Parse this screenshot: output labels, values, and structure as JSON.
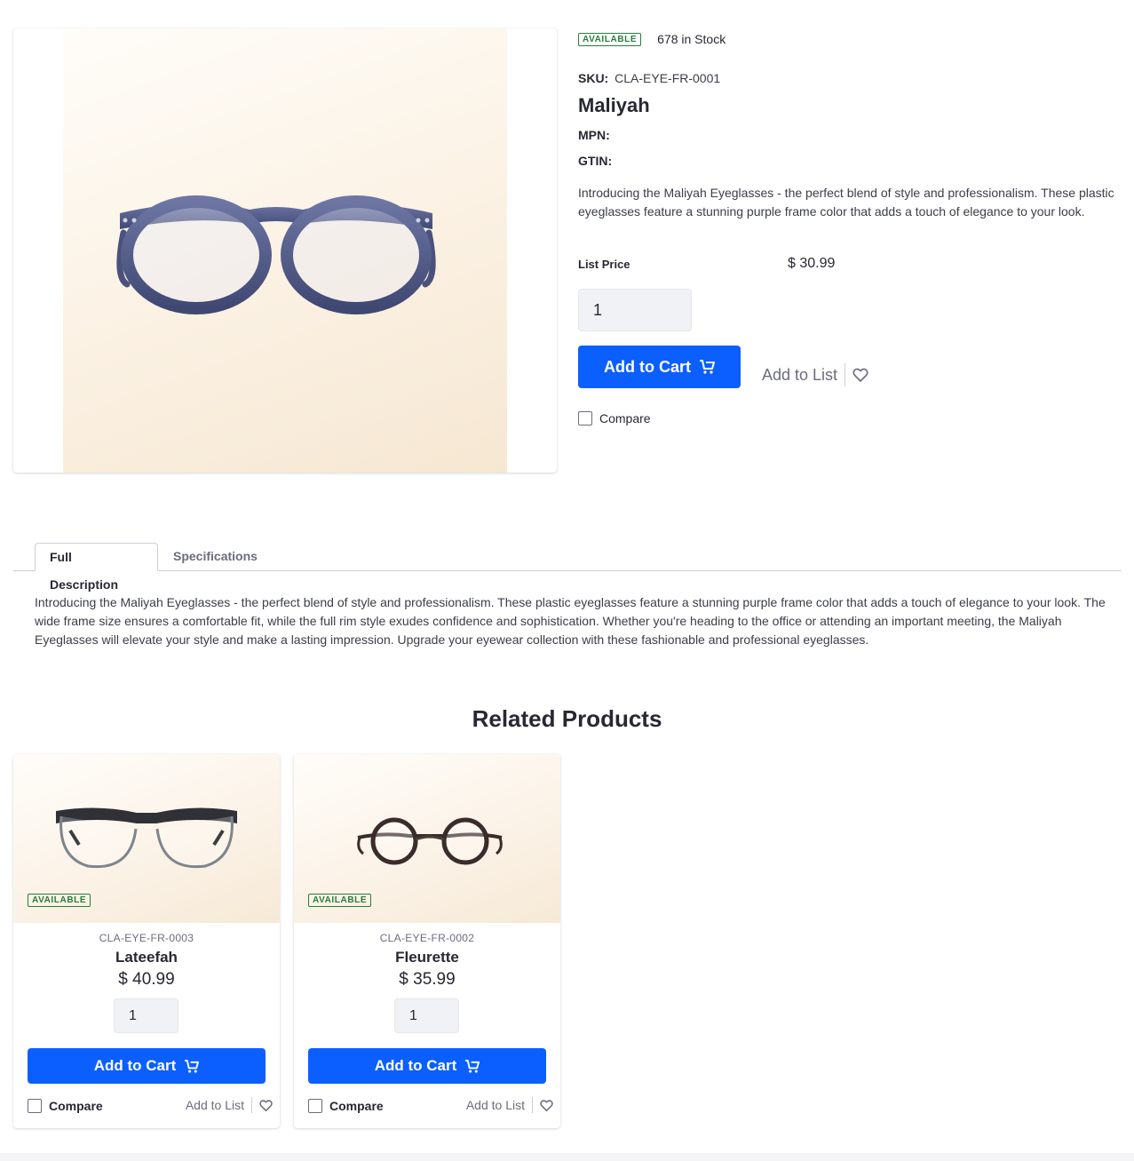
{
  "product": {
    "availability": "AVAILABLE",
    "stock": "678 in Stock",
    "sku_label": "SKU:",
    "sku": "CLA-EYE-FR-0001",
    "name": "Maliyah",
    "mpn_label": "MPN:",
    "gtin_label": "GTIN:",
    "short_description": "Introducing the Maliyah Eyeglasses - the perfect blend of style and professionalism. These plastic eyeglasses feature a stunning purple frame color that adds a touch of elegance to your look.",
    "list_price_label": "List Price",
    "list_price": "$ 30.99",
    "quantity": "1",
    "add_to_cart_label": "Add to Cart",
    "add_to_list_label": "Add to List",
    "compare_label": "Compare",
    "image_icon": "purple-eyeglasses-image"
  },
  "tabs": [
    {
      "label": "Full Description",
      "active": true
    },
    {
      "label": "Specifications",
      "active": false
    }
  ],
  "full_description": "Introducing the Maliyah Eyeglasses - the perfect blend of style and professionalism. These plastic eyeglasses feature a stunning purple frame color that adds a touch of elegance to your look. The wide frame size ensures a comfortable fit, while the full rim style exudes confidence and sophistication. Whether you're heading to the office or attending an important meeting, the Maliyah Eyeglasses will elevate your style and make a lasting impression. Upgrade your eyewear collection with these fashionable and professional eyeglasses.",
  "related": {
    "title": "Related Products",
    "items": [
      {
        "availability": "AVAILABLE",
        "sku": "CLA-EYE-FR-0003",
        "name": "Lateefah",
        "price": "$ 40.99",
        "quantity": "1",
        "add_to_cart_label": "Add to Cart",
        "compare_label": "Compare",
        "add_to_list_label": "Add to List"
      },
      {
        "availability": "AVAILABLE",
        "sku": "CLA-EYE-FR-0002",
        "name": "Fleurette",
        "price": "$ 35.99",
        "quantity": "1",
        "add_to_cart_label": "Add to Cart",
        "compare_label": "Compare",
        "add_to_list_label": "Add to List"
      }
    ]
  },
  "colors": {
    "primary": "#0b5fff",
    "available": "#287d3c",
    "frame_purple": "#4f5a86"
  }
}
